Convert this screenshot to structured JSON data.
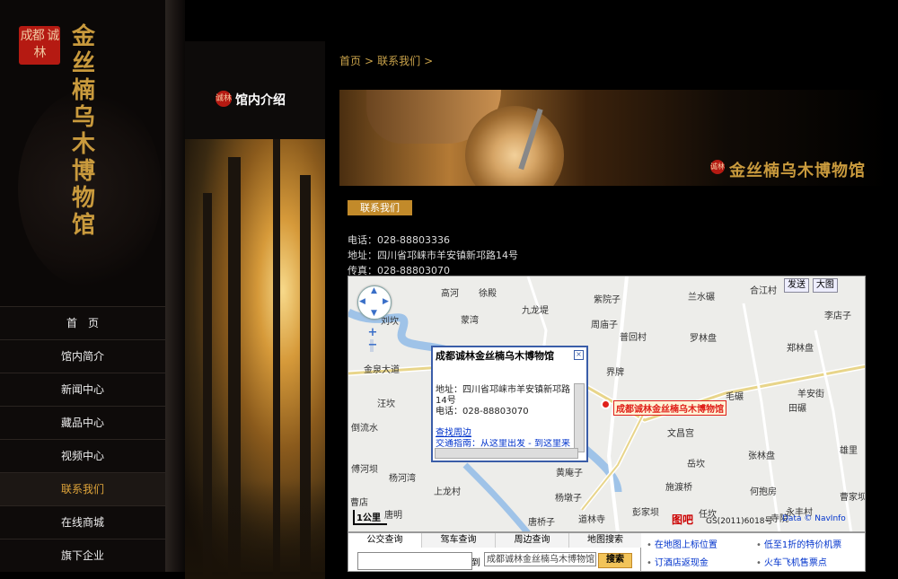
{
  "brand": {
    "seal": "成都 诚林",
    "vertical_title": "金丝楠乌木博物馆"
  },
  "nav": {
    "items": [
      {
        "label": "首　页",
        "active": false
      },
      {
        "label": "馆内简介",
        "active": false
      },
      {
        "label": "新闻中心",
        "active": false
      },
      {
        "label": "藏品中心",
        "active": false
      },
      {
        "label": "视频中心",
        "active": false
      },
      {
        "label": "联系我们",
        "active": true
      },
      {
        "label": "在线商城",
        "active": false
      },
      {
        "label": "旗下企业",
        "active": false
      }
    ]
  },
  "side_panel": {
    "seal": "诚林",
    "title": "馆内介绍"
  },
  "breadcrumb": {
    "items": [
      "首页",
      ">",
      "联系我们",
      ">"
    ]
  },
  "banner": {
    "seal": "诚林",
    "title": "金丝楠乌木博物馆"
  },
  "contact": {
    "tab_label": "联系我们",
    "phone": "电话：028-88803336",
    "address": "地址：四川省邛崃市羊安镇新邛路14号",
    "fax": "传真：028-88803070"
  },
  "map": {
    "buttons": {
      "send": "发送",
      "big": "大图"
    },
    "places": [
      "高河",
      "徐殿",
      "紫院子",
      "蒙湾",
      "九龙堤",
      "合江村",
      "兰水碾",
      "李店子",
      "刘坎",
      "周庙子",
      "普回村",
      "罗林盘",
      "郑林盘",
      "金泉大道",
      "界牌",
      "汪坎",
      "毛碾",
      "倒流水",
      "羊安街",
      "田碾",
      "文昌宫",
      "张林盘",
      "雄里",
      "傅河坝",
      "杨河湾",
      "黄庵子",
      "岳坎",
      "上龙村",
      "杨墩子",
      "施渡桥",
      "何抱房",
      "曹店",
      "唐明",
      "唐桥子",
      "道林寺",
      "彭家坝",
      "任坎",
      "寺院",
      "曹家坝",
      "永丰村"
    ],
    "info_window": {
      "title": "成都诚林金丝楠乌木博物馆",
      "address": "地址：四川省邛崃市羊安镇新邛路14号",
      "phone": "电话：028-88803070",
      "nearby": "查找周边",
      "route": "交通指南：从这里出发 - 到这里来"
    },
    "marker_label": "成都诚林金丝楠乌木博物馆",
    "scale": "1公里",
    "logo": "图吧",
    "copyright": "GS(2011)6018号",
    "data_credit": "Data © NavInfo"
  },
  "search": {
    "tabs": [
      "公交查询",
      "驾车查询",
      "周边查询",
      "地图搜索"
    ],
    "to_label": "到",
    "destination": "成都诚林金丝楠乌木博物馆",
    "button": "搜索"
  },
  "map_links": [
    "在地图上标位置",
    "低至1折的特价机票",
    "订酒店返现金",
    "火车飞机售票点"
  ]
}
